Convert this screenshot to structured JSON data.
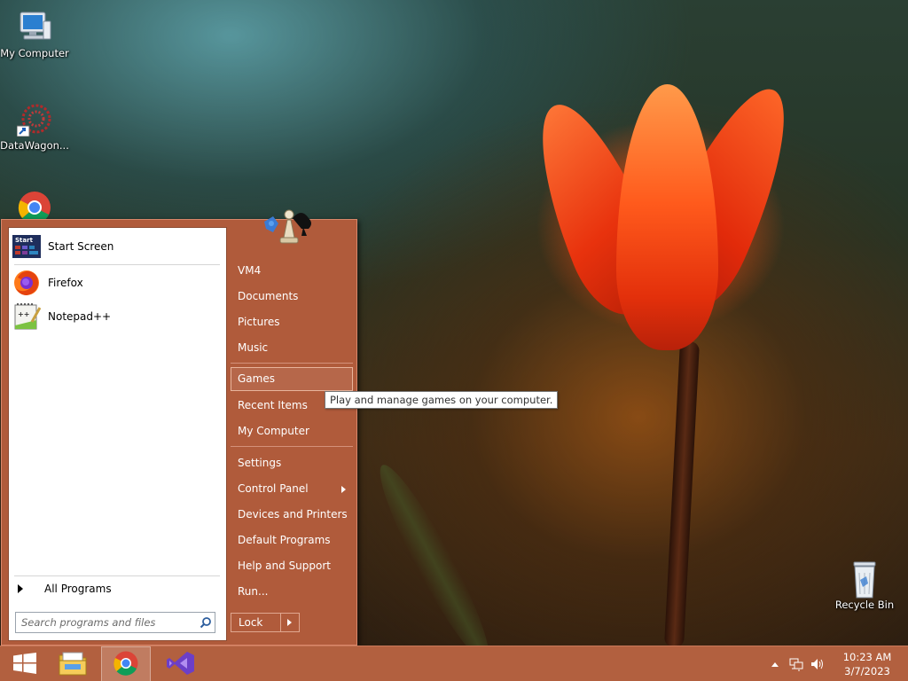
{
  "desktop": {
    "icons": [
      {
        "label": "My Computer"
      },
      {
        "label": "DataWagon..."
      },
      {
        "label": ""
      },
      {
        "label": "Recycle Bin"
      }
    ]
  },
  "start_menu": {
    "pinned": [
      {
        "label": "Start Screen",
        "icon": "start-screen-icon"
      },
      {
        "label": "Firefox",
        "icon": "firefox-icon"
      },
      {
        "label": "Notepad++",
        "icon": "notepad-plus-plus-icon"
      }
    ],
    "all_programs_label": "All Programs",
    "search": {
      "placeholder": "Search programs and files"
    },
    "right_items": [
      {
        "label": "VM4"
      },
      {
        "label": "Documents"
      },
      {
        "label": "Pictures"
      },
      {
        "label": "Music"
      },
      {
        "label": "Games"
      },
      {
        "label": "Recent Items"
      },
      {
        "label": "My Computer"
      },
      {
        "label": "Settings"
      },
      {
        "label": "Control Panel"
      },
      {
        "label": "Devices and Printers"
      },
      {
        "label": "Default Programs"
      },
      {
        "label": "Help and Support"
      },
      {
        "label": "Run..."
      }
    ],
    "lock_label": "Lock",
    "tooltip": "Play and manage games on your computer."
  },
  "taskbar": {
    "buttons": [
      {
        "icon": "windows-start-icon"
      },
      {
        "icon": "file-explorer-icon"
      },
      {
        "icon": "chrome-icon"
      },
      {
        "icon": "visual-studio-icon"
      }
    ],
    "clock": {
      "time": "10:23 AM",
      "date": "3/7/2023"
    }
  },
  "colors": {
    "menu_accent": "#b05b3b",
    "taskbar": "#b2603f"
  }
}
